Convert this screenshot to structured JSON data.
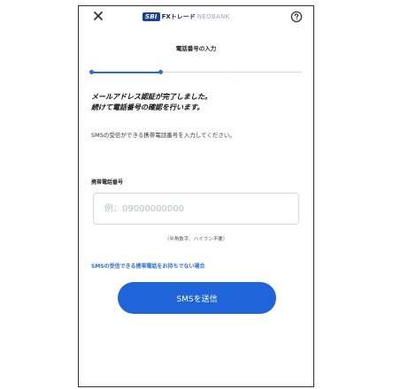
{
  "header": {
    "brand_logo": "SBI",
    "brand_name": "FXトレード",
    "brand_sub": "NEOBANK",
    "close_icon": "close-icon",
    "help_icon": "help-circle-icon"
  },
  "page": {
    "title": "電話番号の入力"
  },
  "stepper": {
    "total_steps": 4,
    "current_step": 2,
    "active_color": "#2a6fd6",
    "inactive_color": "#cfd8ea"
  },
  "message": {
    "line1": "メールアドレス認証が完了しました。",
    "line2": "続けて電話番号の確認を行います。"
  },
  "description": "SMSの受信ができる携帯電話番号を入力してください。",
  "form": {
    "label": "携帯電話番号",
    "placeholder": "例：09000000000",
    "value": "",
    "hint": "（半角数字、ハイフン不要）"
  },
  "links": {
    "sms_help": "SMSの受信できる携帯電話をお持ちでない場合"
  },
  "actions": {
    "send_sms": "SMSを送信"
  },
  "colors": {
    "primary": "#1f64d8",
    "brand": "#1f3f9a"
  }
}
